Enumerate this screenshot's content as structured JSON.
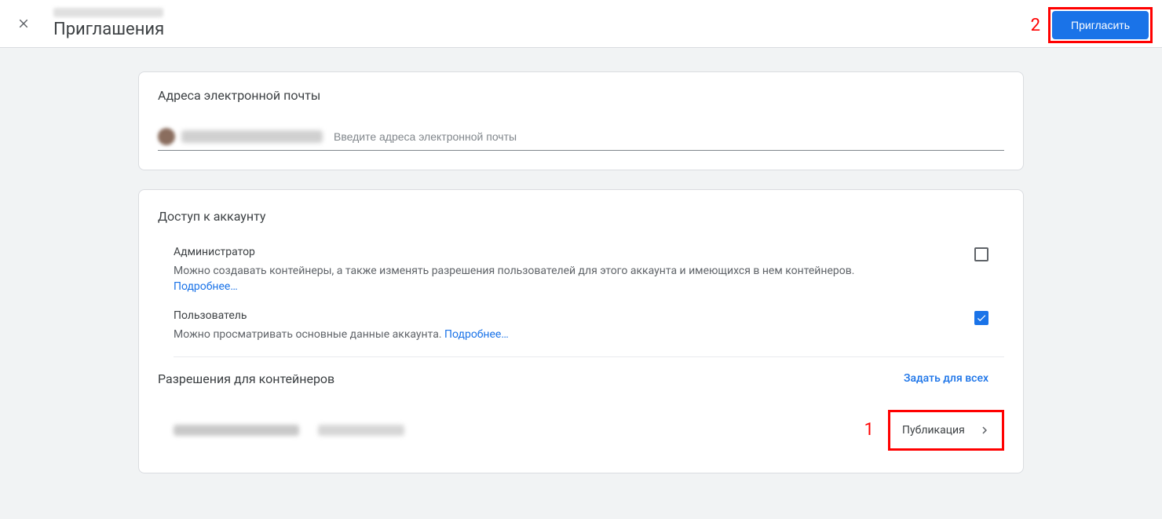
{
  "header": {
    "title": "Приглашения",
    "invite_button": "Пригласить"
  },
  "annotations": {
    "one": "1",
    "two": "2"
  },
  "email_card": {
    "title": "Адреса электронной почты",
    "placeholder": "Введите адреса электронной почты"
  },
  "access_card": {
    "title": "Доступ к аккаунту",
    "admin": {
      "name": "Администратор",
      "desc": "Можно создавать контейнеры, а также изменять разрешения пользователей для этого аккаунта и имеющихся в нем контейнеров.",
      "learn_more": "Подробнее…",
      "checked": false
    },
    "user": {
      "name": "Пользователь",
      "desc": "Можно просматривать основные данные аккаунта.",
      "learn_more": "Подробнее…",
      "checked": true
    }
  },
  "containers": {
    "title": "Разрешения для контейнеров",
    "set_all": "Задать для всех",
    "row": {
      "permission": "Публикация"
    }
  }
}
